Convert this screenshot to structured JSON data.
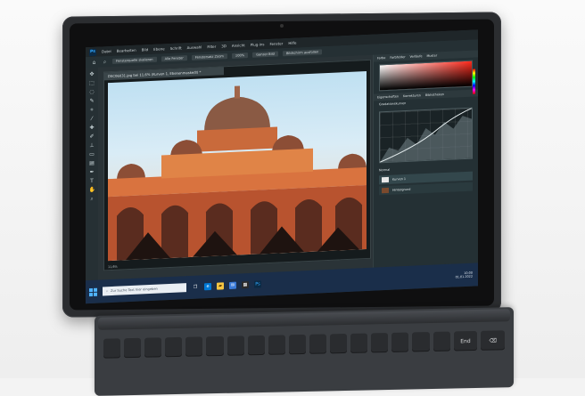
{
  "photoshop": {
    "logo": "Ps",
    "menu": [
      "Datei",
      "Bearbeiten",
      "Bild",
      "Ebene",
      "Schrift",
      "Auswahl",
      "Filter",
      "3D",
      "Ansicht",
      "Plug-ins",
      "Fenster",
      "Hilfe"
    ],
    "options": [
      "Fensterquelle skalieren",
      "Alle Fenster",
      "Fenstersatz Zoom",
      "100%",
      "Ganzer Bild",
      "Bildschirm ausfüllen"
    ],
    "doc_title": "DSC06031.jpg bei 11,6% (Kurven 1, Ebenenmaske/8) *",
    "doc_status": "11,6%",
    "panel_tabs_top": [
      "Farbe",
      "Farbfelder",
      "Verläufe",
      "Muster"
    ],
    "panel_tabs_props": [
      "Eigenschaften",
      "Korrekturen",
      "Bibliotheken"
    ],
    "panel_props_label": "Gradationskurven",
    "layers": [
      "Kurven 1",
      "Hintergrund"
    ],
    "layers_mode": "Normal"
  },
  "taskbar": {
    "search_placeholder": "Zur Suche Text hier eingeben",
    "time": "10:00",
    "date": "01.01.2022"
  },
  "keyboard": {
    "end_key": "End",
    "visible_keys": [
      "",
      "",
      "",
      "",
      "",
      "",
      "",
      "",
      "",
      "",
      "",
      "",
      "",
      "",
      "",
      "",
      "",
      "",
      "",
      "End",
      "⌫"
    ]
  },
  "colors": {
    "ps_accent": "#31a8ff",
    "taskbar": "#1a2e4a",
    "tablet_frame": "#2b2d30"
  }
}
